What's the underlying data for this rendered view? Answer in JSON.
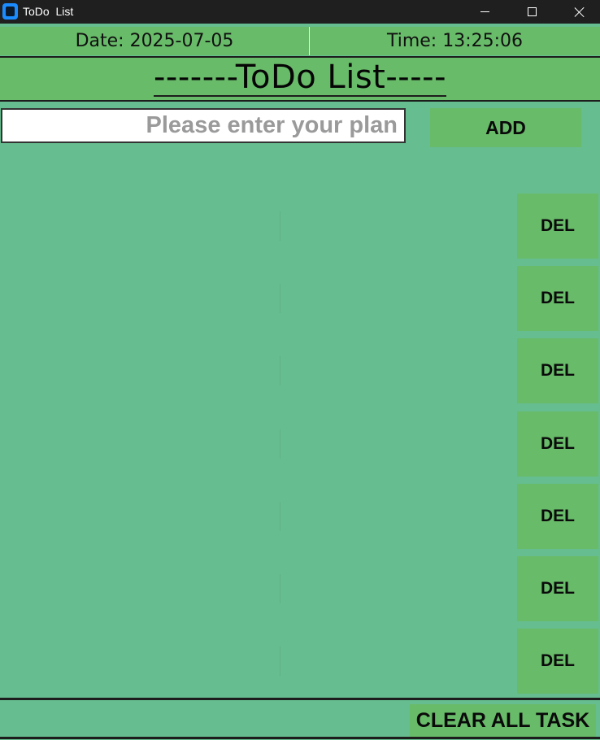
{
  "window": {
    "title": "ToDo  List",
    "icon": "app-icon",
    "controls": [
      "minimize-icon",
      "maximize-icon",
      "close-icon"
    ]
  },
  "header": {
    "date_text": "Date: 2025-07-05",
    "time_text": "Time: 13:25:06"
  },
  "title": "-------ToDo List-----",
  "input": {
    "value": "",
    "placeholder": "Please enter your plan"
  },
  "add_label": "ADD",
  "tasks": [
    {
      "text": "",
      "del_label": "DEL"
    },
    {
      "text": "",
      "del_label": "DEL"
    },
    {
      "text": "",
      "del_label": "DEL"
    },
    {
      "text": "",
      "del_label": "DEL"
    },
    {
      "text": "",
      "del_label": "DEL"
    },
    {
      "text": "",
      "del_label": "DEL"
    },
    {
      "text": "",
      "del_label": "DEL"
    }
  ],
  "clear_label": "CLEAR ALL TASK",
  "colors": {
    "background": "#66bd8f",
    "bar_green": "#68bb69",
    "titlebar": "#1f1f1f",
    "accent_icon": "#1a8cff"
  }
}
